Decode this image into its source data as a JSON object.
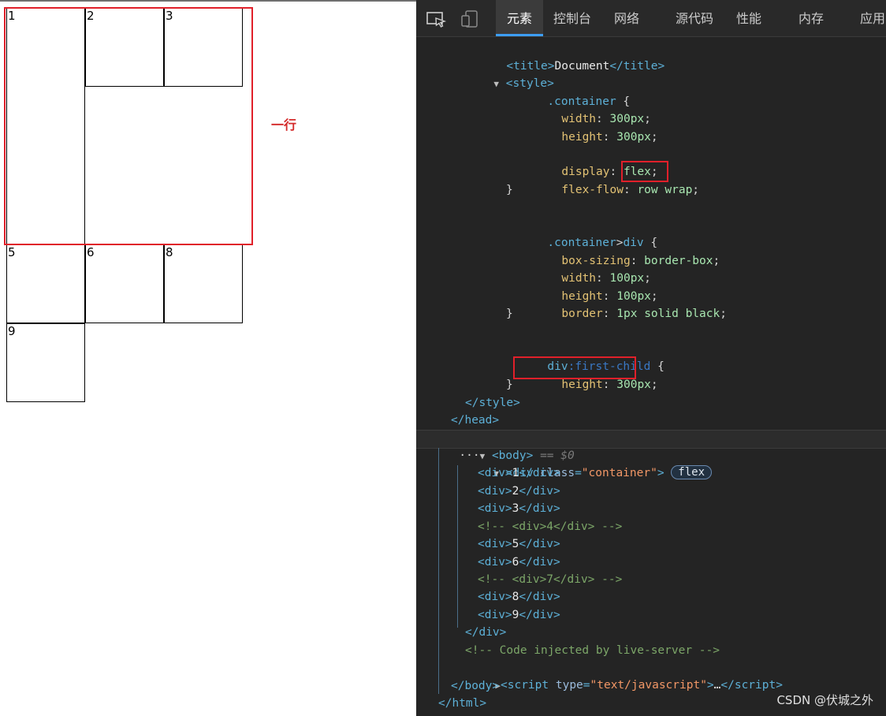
{
  "demo": {
    "cells": [
      "1",
      "2",
      "3",
      "5",
      "6",
      "8",
      "9"
    ],
    "annotation": "一行"
  },
  "devtools": {
    "tabs": [
      "元素",
      "控制台",
      "网络",
      "源代码",
      "性能",
      "内存",
      "应用"
    ],
    "active_tab": "元素"
  },
  "code": {
    "title_text": "Document",
    "container_selector": ".container",
    "w_prop": "width",
    "w_val": "300px",
    "h_prop": "height",
    "h_val": "300px",
    "display_prop": "display",
    "display_val": "flex",
    "flow_prop": "flex-flow",
    "flow_val1": "row",
    "flow_val2": "wrap",
    "child_selector_a": ".container",
    "child_selector_b": "div",
    "bs_prop": "box-sizing",
    "bs_val": "border-box",
    "cw_prop": "width",
    "cw_val": "100px",
    "ch_prop": "height",
    "ch_val": "100px",
    "border_prop": "border",
    "border_val1": "1px",
    "border_val2": "solid black",
    "fc_sel": "div",
    "fc_pseudo": ":first-child",
    "fc_prop": "height",
    "fc_val": "300px",
    "body_marker": "== $0",
    "div_class_attr": "class",
    "div_class_val": "\"container\"",
    "flex_badge": "flex",
    "div_texts": [
      "1",
      "2",
      "3",
      "5",
      "6",
      "8",
      "9"
    ],
    "comment_4": "<!-- <div>4</div> -->",
    "comment_7": "<!-- <div>7</div> -->",
    "comment_live": "<!-- Code injected by live-server -->",
    "script_type_attr": "type",
    "script_type_val": "\"text/javascript\"",
    "ellipsis": "…"
  },
  "watermark": "CSDN @伏城之外"
}
